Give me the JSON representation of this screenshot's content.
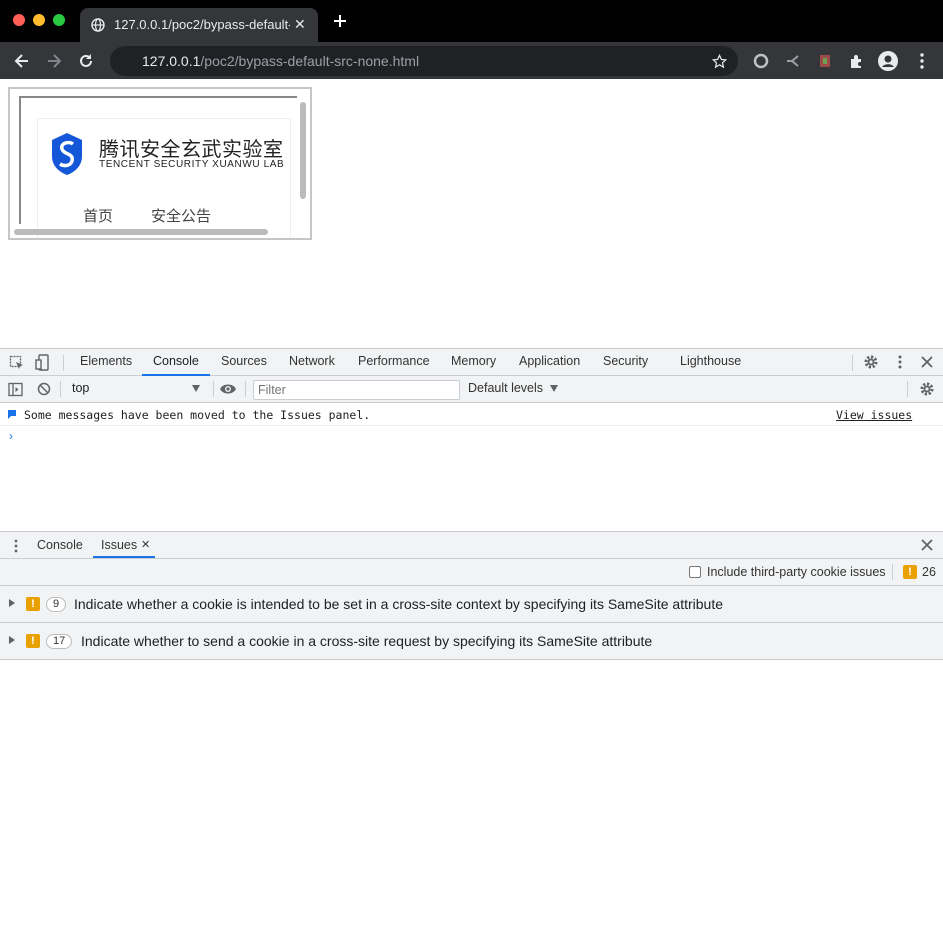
{
  "browser": {
    "tab_title": "127.0.0.1/poc2/bypass-default-src-none.html",
    "tab_close": "✕",
    "new_tab": "+",
    "url_host": "127.0.0.1",
    "url_path": "/poc2/bypass-default-src-none.html"
  },
  "page": {
    "brand_zh": "腾讯安全玄武实验室",
    "brand_en": "TENCENT SECURITY XUANWU LAB",
    "nav": [
      "首页",
      "安全公告"
    ],
    "brand_color": "#1457d8"
  },
  "devtools": {
    "tabs": [
      "Elements",
      "Console",
      "Sources",
      "Network",
      "Performance",
      "Memory",
      "Application",
      "Security",
      "Lighthouse"
    ],
    "active_tab": "Console",
    "context": "top",
    "filter_placeholder": "Filter",
    "levels": "Default levels",
    "message": "Some messages have been moved to the Issues panel.",
    "view_issues": "View issues",
    "prompt": "›",
    "accent": "#1a73e8"
  },
  "drawer": {
    "tabs": [
      "Console",
      "Issues"
    ],
    "active_tab": "Issues",
    "close_tab": "✕",
    "include_third_party": "Include third-party cookie issues",
    "issue_count": "26",
    "warn_mark": "!",
    "issues": [
      {
        "count": "9",
        "text": "Indicate whether a cookie is intended to be set in a cross-site context by specifying its SameSite attribute"
      },
      {
        "count": "17",
        "text": "Indicate whether to send a cookie in a cross-site request by specifying its SameSite attribute"
      }
    ],
    "warn_color": "#e8a100"
  }
}
